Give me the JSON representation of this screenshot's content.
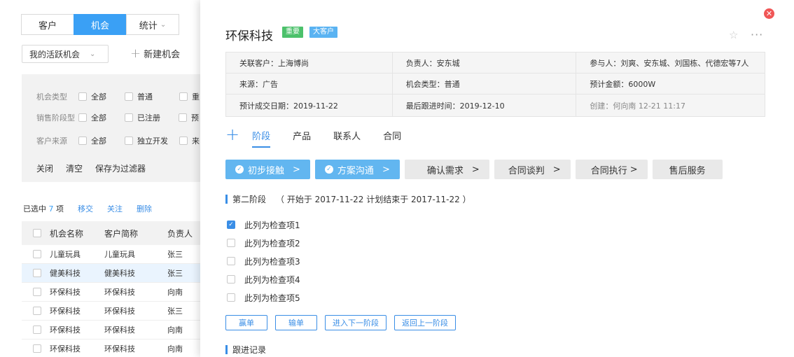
{
  "nav": {
    "tabs": [
      {
        "label": "客户"
      },
      {
        "label": "机会"
      },
      {
        "label": "统计"
      }
    ],
    "scope_select": "我的活跃机会",
    "new_button": "新建机会"
  },
  "filters": {
    "rows": [
      {
        "label": "机会类型",
        "options": [
          "全部",
          "普通",
          "重"
        ]
      },
      {
        "label": "销售阶段型",
        "options": [
          "全部",
          "已注册",
          "预"
        ]
      },
      {
        "label": "客户来源",
        "options": [
          "全部",
          "独立开发",
          "来"
        ]
      }
    ],
    "actions": [
      "关闭",
      "清空",
      "保存为过滤器"
    ]
  },
  "selection": {
    "prefix": "已选中",
    "count": "7",
    "suffix": "项",
    "actions": [
      "移交",
      "关注",
      "删除"
    ]
  },
  "table": {
    "headers": [
      "机会名称",
      "客户简称",
      "负责人"
    ],
    "rows": [
      {
        "name": "儿童玩具",
        "customer": "儿童玩具",
        "owner": "张三"
      },
      {
        "name": "健美科技",
        "customer": "健美科技",
        "owner": "张三"
      },
      {
        "name": "环保科技",
        "customer": "环保科技",
        "owner": "向南"
      },
      {
        "name": "环保科技",
        "customer": "环保科技",
        "owner": "张三"
      },
      {
        "name": "环保科技",
        "customer": "环保科技",
        "owner": "向南"
      },
      {
        "name": "环保科技",
        "customer": "环保科技",
        "owner": "向南"
      }
    ]
  },
  "detail": {
    "title": "环保科技",
    "tags": [
      "重要",
      "大客户"
    ],
    "info": [
      [
        "关联客户：上海博尚",
        "负责人：安东城",
        "参与人：刘爽、安东城、刘国栋、代德宏等7人"
      ],
      [
        "来源：广告",
        "机会类型：普通",
        "预计金额：6000W"
      ],
      [
        "预计成交日期：2019-11-22",
        "最后跟进时间：2019-12-10",
        "创建：何向南  12-21  11:17"
      ]
    ],
    "sub_tabs": [
      "阶段",
      "产品",
      "联系人",
      "合同"
    ],
    "stages": [
      {
        "label": "初步接触",
        "done": true
      },
      {
        "label": "方案沟通",
        "done": true
      },
      {
        "label": "确认需求",
        "done": false
      },
      {
        "label": "合同谈判",
        "done": false
      },
      {
        "label": "合同执行",
        "done": false
      },
      {
        "label": "售后服务",
        "done": false
      }
    ],
    "stage_section": {
      "title": "第二阶段",
      "dates": "（  开始于 2017-11-22    计划结束于 2017-11-22 ）"
    },
    "checklist": [
      {
        "label": "此列为检查项1",
        "checked": true
      },
      {
        "label": "此列为检查项2",
        "checked": false
      },
      {
        "label": "此列为检查项3",
        "checked": false
      },
      {
        "label": "此列为检查项4",
        "checked": false
      },
      {
        "label": "此列为检查项5",
        "checked": false
      }
    ],
    "actions": [
      "赢单",
      "输单",
      "进入下一阶段",
      "返回上一阶段"
    ],
    "followup_title": "跟进记录"
  },
  "colors": {
    "primary": "#3a8ee6",
    "active_tab": "#3aa0f5",
    "stage_done": "#62b6f0",
    "tag_important": "#4cc16b",
    "tag_key_account": "#5ab3f2",
    "close": "#f05656"
  }
}
